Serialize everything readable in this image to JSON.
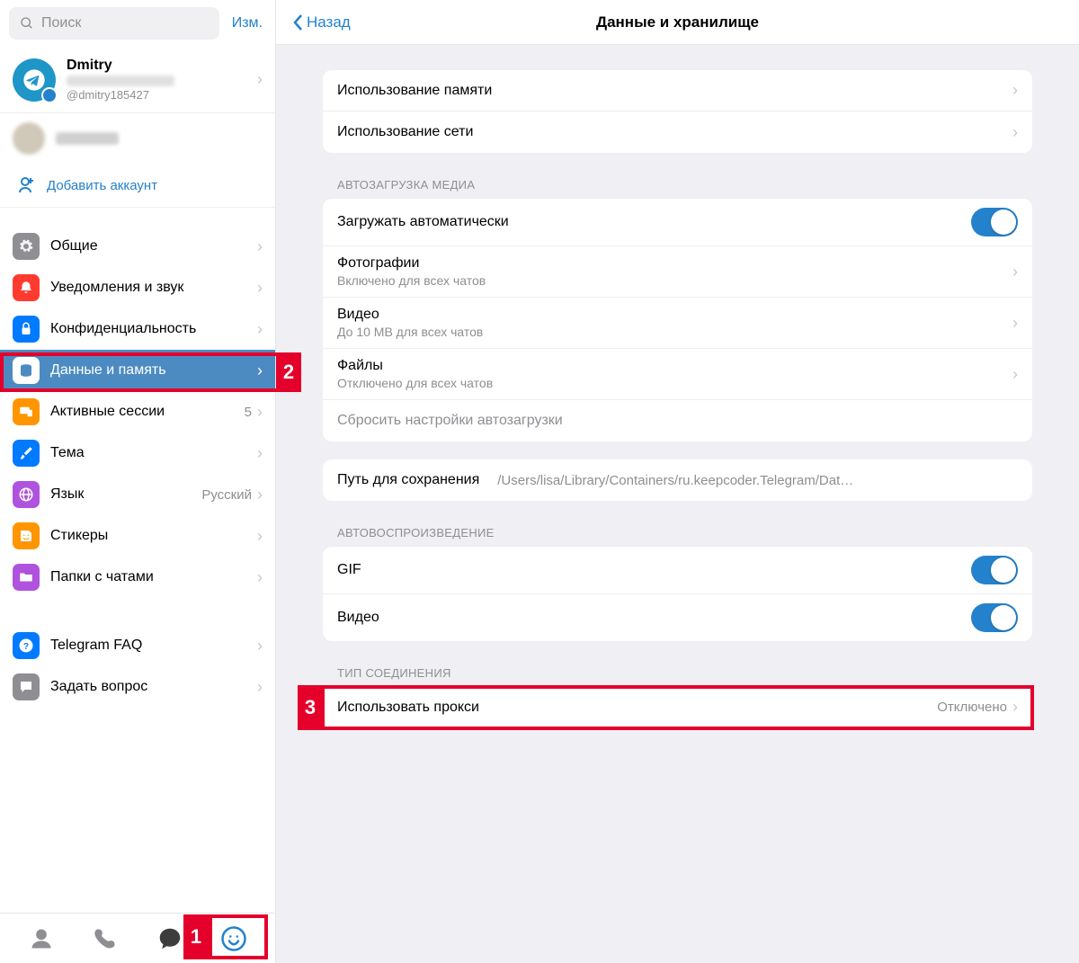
{
  "search": {
    "placeholder": "Поиск"
  },
  "edit": "Изм.",
  "profile": {
    "name": "Dmitry",
    "username": "@dmitry185427"
  },
  "add_account": "Добавить аккаунт",
  "menu": {
    "general": "Общие",
    "notifications": "Уведомления и звук",
    "privacy": "Конфиденциальность",
    "data": "Данные и память",
    "sessions": "Активные сессии",
    "sessions_count": "5",
    "theme": "Тема",
    "language": "Язык",
    "language_value": "Русский",
    "stickers": "Стикеры",
    "folders": "Папки с чатами",
    "faq": "Telegram FAQ",
    "ask": "Задать вопрос"
  },
  "header": {
    "back": "Назад",
    "title": "Данные и хранилище"
  },
  "storage": {
    "memory": "Использование памяти",
    "network": "Использование сети"
  },
  "autodownload": {
    "section": "АВТОЗАГРУЗКА МЕДИА",
    "auto": "Загружать автоматически",
    "photos": "Фотографии",
    "photos_sub": "Включено для всех чатов",
    "video": "Видео",
    "video_sub": "До 10 MB для всех чатов",
    "files": "Файлы",
    "files_sub": "Отключено для всех чатов",
    "reset": "Сбросить настройки автозагрузки"
  },
  "savepath": {
    "label": "Путь для сохранения",
    "value": "/Users/lisa/Library/Containers/ru.keepcoder.Telegram/Data/..."
  },
  "autoplay": {
    "section": "АВТОВОСПРОИЗВЕДЕНИЕ",
    "gif": "GIF",
    "video": "Видео"
  },
  "connection": {
    "section": "ТИП СОЕДИНЕНИЯ",
    "proxy": "Использовать прокси",
    "proxy_value": "Отключено"
  },
  "annotations": {
    "a1": "1",
    "a2": "2",
    "a3": "3"
  }
}
